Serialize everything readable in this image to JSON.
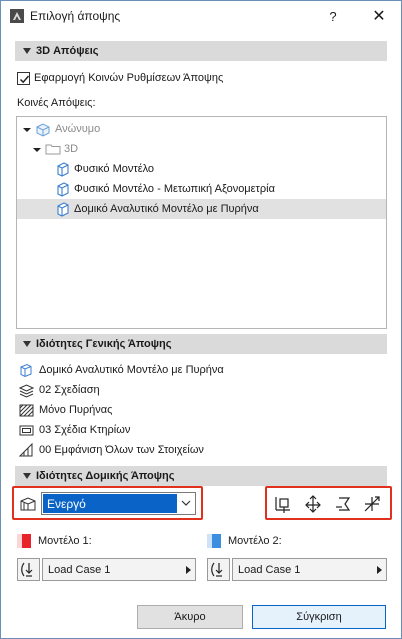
{
  "window": {
    "title": "Επιλογή άποψης",
    "help_label": "?",
    "close_label": "✕"
  },
  "section_3d": {
    "header": "3D Απόψεις",
    "checkbox_label": "Εφαρμογή Κοινών Ρυθμίσεων Άποψης",
    "checkbox_checked": true,
    "common_views_label": "Κοινές Απόψεις:",
    "tree": {
      "root": "Ανώνυμο",
      "folder": "3D",
      "items": [
        "Φυσικό Μοντέλο",
        "Φυσικό Μοντέλο - Μετωπική Αξονομετρία",
        "Δομικό Αναλυτικό Μοντέλο με Πυρήνα"
      ],
      "selected_index": 2
    }
  },
  "section_general": {
    "header": "Ιδιότητες Γενικής Άποψης",
    "props": [
      {
        "icon": "model-view-icon",
        "text": "Δομικό Αναλυτικό Μοντέλο με Πυρήνα"
      },
      {
        "icon": "layers-icon",
        "text": "02 Σχεδίαση"
      },
      {
        "icon": "structure-icon",
        "text": "Μόνο Πυρήνας"
      },
      {
        "icon": "pen-set-icon",
        "text": "03 Σχέδια Κτηρίων"
      },
      {
        "icon": "partial-display-icon",
        "text": "00 Εμφάνιση Όλων των Στοιχείων"
      }
    ]
  },
  "section_structural": {
    "header": "Ιδιότητες Δομικής Άποψης",
    "combo_value": "Ενεργό",
    "model1_label": "Μοντέλο 1:",
    "model1_color": "#e8232b",
    "model2_label": "Μοντέλο 2:",
    "model2_color": "#3b8ee0",
    "loadcase1": "Load Case 1",
    "loadcase2": "Load Case 1"
  },
  "buttons": {
    "cancel": "Άκυρο",
    "compare": "Σύγκριση"
  },
  "colors": {
    "accent": "#0a64c8",
    "highlight_box": "#e0301e",
    "section_bg": "#dadada",
    "selection_bg": "#e1e1e1"
  }
}
